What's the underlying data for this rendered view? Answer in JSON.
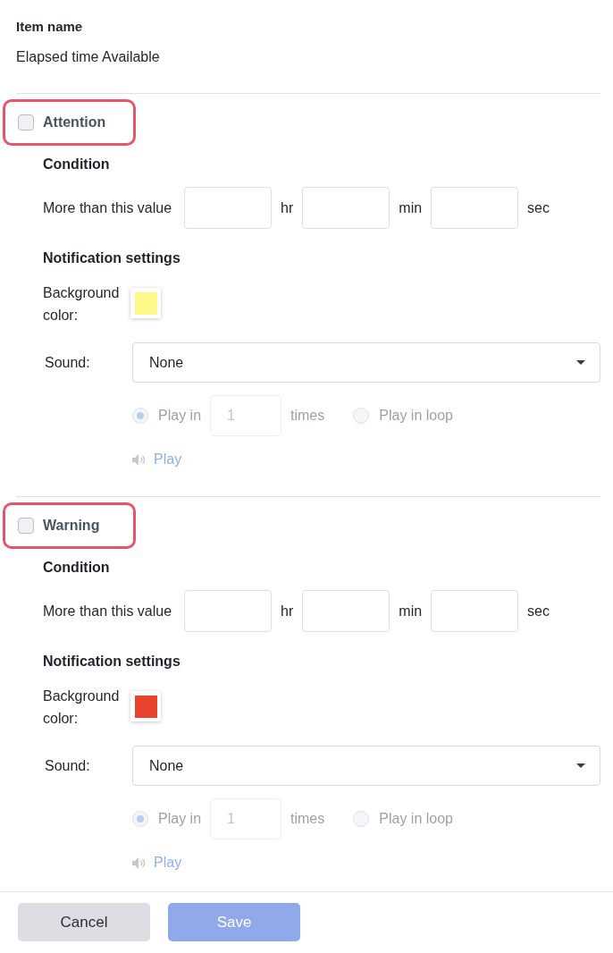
{
  "header": {
    "label": "Item name",
    "value": "Elapsed time Available"
  },
  "sections": [
    {
      "title": "Attention",
      "checked": false,
      "highlighted": true,
      "condition": {
        "heading": "Condition",
        "label": "More than this value",
        "fields": [
          {
            "unit": "hr"
          },
          {
            "unit": "min"
          },
          {
            "unit": "sec"
          }
        ]
      },
      "notification": {
        "heading": "Notification settings",
        "background_label": "Background color:",
        "color": "#fff98a",
        "sound_label": "Sound:",
        "sound_value": "None",
        "playback_disabled": true,
        "options": [
          {
            "kind": "count",
            "label": "Play in",
            "selected": true,
            "count": "1",
            "suffix": "times"
          },
          {
            "kind": "loop",
            "label": "Play in loop",
            "selected": false
          }
        ],
        "play_link": "Play"
      }
    },
    {
      "title": "Warning",
      "checked": false,
      "highlighted": true,
      "condition": {
        "heading": "Condition",
        "label": "More than this value",
        "fields": [
          {
            "unit": "hr"
          },
          {
            "unit": "min"
          },
          {
            "unit": "sec"
          }
        ]
      },
      "notification": {
        "heading": "Notification settings",
        "background_label": "Background color:",
        "color": "#e8432f",
        "sound_label": "Sound:",
        "sound_value": "None",
        "playback_disabled": true,
        "options": [
          {
            "kind": "count",
            "label": "Play in",
            "selected": true,
            "count": "1",
            "suffix": "times"
          },
          {
            "kind": "loop",
            "label": "Play in loop",
            "selected": false
          }
        ],
        "play_link": "Play"
      }
    }
  ],
  "buttons": [
    {
      "label": "Cancel",
      "kind": "secondary",
      "disabled": false
    },
    {
      "label": "Save",
      "kind": "primary",
      "disabled": true
    }
  ]
}
